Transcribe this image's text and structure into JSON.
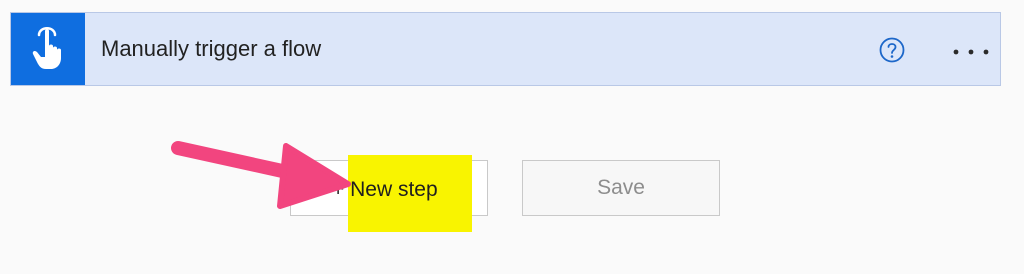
{
  "trigger": {
    "title": "Manually trigger a flow",
    "icon": "touch-hand-icon",
    "help_icon": "help-icon",
    "more_icon": "more-options-icon",
    "accent_color": "#0f6ee0",
    "background_color": "#dce6f9"
  },
  "actions": {
    "new_step_label": "+ New step",
    "save_label": "Save"
  },
  "annotation": {
    "arrow_color": "#f2457f",
    "highlight_color": "#f9f400"
  }
}
